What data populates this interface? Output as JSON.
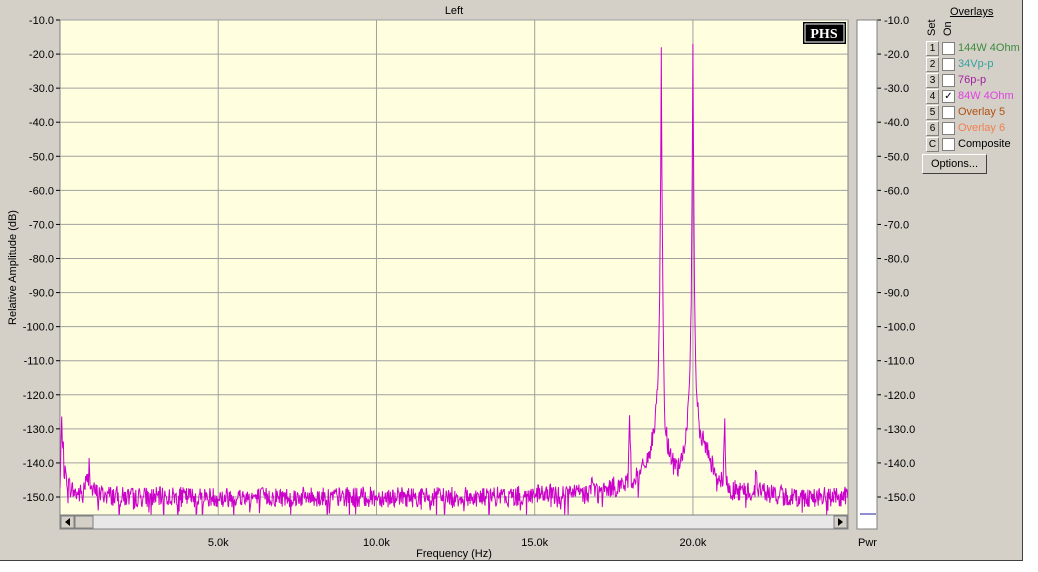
{
  "chart_data": {
    "type": "line",
    "title": "Left",
    "xlabel": "Frequency (Hz)",
    "ylabel": "Relative Amplitude (dB)",
    "xlim": [
      0,
      24900
    ],
    "ylim": [
      -155,
      -10
    ],
    "x_ticks": [
      5000,
      10000,
      15000,
      20000
    ],
    "x_tick_labels": [
      "5.0k",
      "10.0k",
      "15.0k",
      "20.0k"
    ],
    "y_ticks": [
      -10,
      -20,
      -30,
      -40,
      -50,
      -60,
      -70,
      -80,
      -90,
      -100,
      -110,
      -120,
      -130,
      -140,
      -150
    ],
    "y_tick_labels": [
      "-10.0",
      "-20.0",
      "-30.0",
      "-40.0",
      "-50.0",
      "-60.0",
      "-70.0",
      "-80.0",
      "-90.0",
      "-100.0",
      "-110.0",
      "-120.0",
      "-130.0",
      "-140.0",
      "-150.0"
    ],
    "grid": true,
    "noise_floor_db": -150,
    "series": [
      {
        "name": "84W 4Ohm",
        "color": "#cc00cc",
        "x": [
          0,
          50,
          150,
          300,
          500,
          700,
          800,
          900,
          930,
          950,
          1000,
          1200,
          2000,
          4000,
          6000,
          8000,
          10000,
          12000,
          14000,
          16000,
          16700,
          16800,
          17000,
          17500,
          17950,
          18000,
          18050,
          18300,
          18600,
          18800,
          18900,
          18950,
          18980,
          19000,
          19020,
          19050,
          19100,
          19200,
          19400,
          19500,
          19600,
          19700,
          19800,
          19900,
          19950,
          19980,
          20000,
          20020,
          20050,
          20100,
          20200,
          20400,
          20600,
          20800,
          20950,
          21000,
          21050,
          21200,
          21500,
          21950,
          22000,
          22050,
          22500,
          23000,
          24000,
          24900
        ],
        "y": [
          -148,
          -128,
          -143,
          -147,
          -149,
          -149,
          -146,
          -145,
          -137,
          -145,
          -148,
          -149,
          -150,
          -150,
          -150,
          -150,
          -150,
          -150,
          -150,
          -149,
          -149,
          -146,
          -149,
          -147,
          -146,
          -124,
          -145,
          -144,
          -138,
          -130,
          -115,
          -90,
          -55,
          -18,
          -55,
          -90,
          -125,
          -135,
          -140,
          -142,
          -141,
          -137,
          -130,
          -115,
          -90,
          -52,
          -17,
          -52,
          -90,
          -118,
          -130,
          -135,
          -140,
          -144,
          -146,
          -127,
          -146,
          -148,
          -148,
          -149,
          -140,
          -148,
          -149,
          -150,
          -150,
          -150
        ]
      }
    ],
    "right_axis_label": "Pwr"
  },
  "logo": "PHS",
  "overlays": {
    "title": "Overlays",
    "set_header": "Set",
    "on_header": "On",
    "items": [
      {
        "set": "1",
        "label": "144W 4Ohm",
        "checked": false,
        "color": "#3c8c3c"
      },
      {
        "set": "2",
        "label": "34Vp-p",
        "checked": false,
        "color": "#34a0a0"
      },
      {
        "set": "3",
        "label": "76p-p",
        "checked": false,
        "color": "#a020a0"
      },
      {
        "set": "4",
        "label": "84W 4Ohm",
        "checked": true,
        "color": "#e040e0"
      },
      {
        "set": "5",
        "label": "Overlay 5",
        "checked": false,
        "color": "#b05010"
      },
      {
        "set": "6",
        "label": "Overlay 6",
        "checked": false,
        "color": "#f08050"
      },
      {
        "set": "C",
        "label": "Composite",
        "checked": false,
        "color": "#000000"
      }
    ],
    "options_label": "Options..."
  },
  "colors": {
    "plot_bg": "#ffffe0",
    "grid": "#a0a0a0",
    "trace": "#cc00cc",
    "window": "#d4d0c8"
  }
}
